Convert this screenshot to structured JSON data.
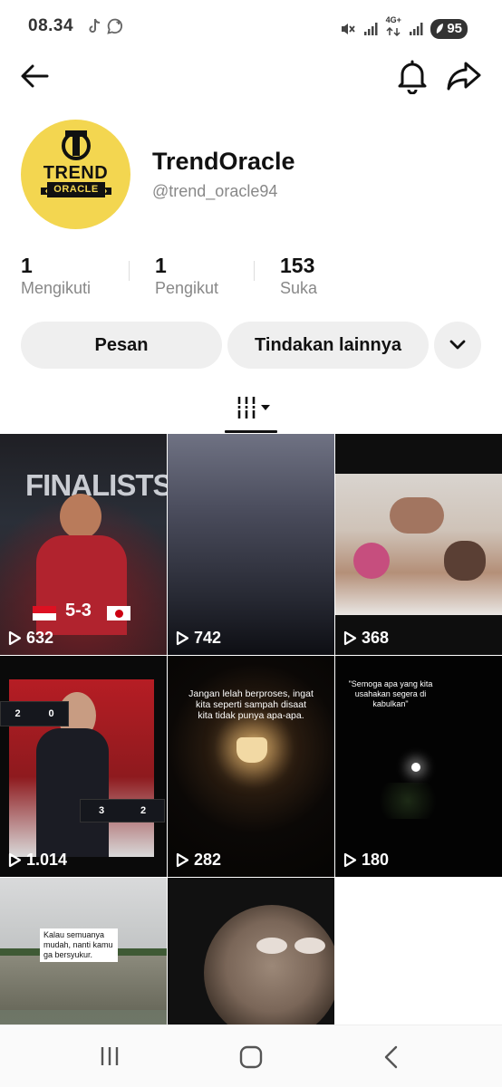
{
  "status_bar": {
    "time": "08.34",
    "network_type": "4G+",
    "battery": "95",
    "icons": [
      "tiktok-icon",
      "whatsapp-icon",
      "mute-icon",
      "signal-icon",
      "signal-icon",
      "battery-icon"
    ]
  },
  "header": {
    "icons": [
      "back-arrow-icon",
      "bell-icon",
      "share-icon"
    ]
  },
  "profile": {
    "avatar_title": "TREND",
    "avatar_subtitle": "ORACLE",
    "display_name": "TrendOracle",
    "username": "@trend_oracle94"
  },
  "stats": [
    {
      "value": "1",
      "label": "Mengikuti"
    },
    {
      "value": "1",
      "label": "Pengikut"
    },
    {
      "value": "153",
      "label": "Suka"
    }
  ],
  "actions": {
    "message_label": "Pesan",
    "more_label": "Tindakan lainnya",
    "expand_icon": "chevron-down-icon"
  },
  "tabs": {
    "grid_icon": "grid-filter-icon"
  },
  "videos": [
    {
      "views": "632",
      "headline": "FINALISTS",
      "score": "5-3"
    },
    {
      "views": "742"
    },
    {
      "views": "368"
    },
    {
      "views": "1.014",
      "scoreboard_1": "2",
      "scoreboard_2": "0",
      "scoreboard_3": "3",
      "scoreboard_4": "2"
    },
    {
      "views": "282",
      "caption": "Jangan lelah berproses, ingat kita seperti sampah disaat kita tidak punya apa-apa."
    },
    {
      "views": "180",
      "caption": "\"Semoga apa yang kita usahakan segera di kabulkan\""
    },
    {
      "caption": "Kalau semuanya mudah, nanti kamu ga bersyukur."
    },
    {}
  ],
  "nav": {
    "icons": [
      "recent-apps-icon",
      "home-icon",
      "back-icon"
    ]
  }
}
